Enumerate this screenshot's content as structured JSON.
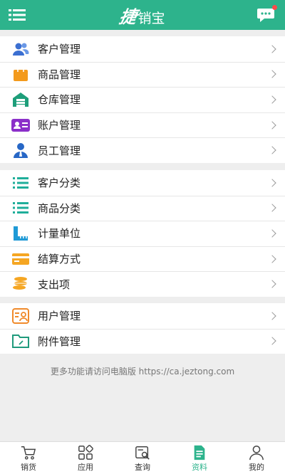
{
  "header": {
    "logo_mark": "捷",
    "logo_rest": "销宝",
    "menu_icon": "menu-icon",
    "chat_icon": "chat-bubble-icon",
    "accent": "#2db38c"
  },
  "groups": [
    {
      "items": [
        {
          "label": "客户管理",
          "icon": "customers-icon",
          "color": "#3b6fd1"
        },
        {
          "label": "商品管理",
          "icon": "shopping-bag-icon",
          "color": "#f39a1c"
        },
        {
          "label": "仓库管理",
          "icon": "warehouse-icon",
          "color": "#1e9e7a"
        },
        {
          "label": "账户管理",
          "icon": "account-card-icon",
          "color": "#8b2fc9"
        },
        {
          "label": "员工管理",
          "icon": "employee-icon",
          "color": "#2767c6"
        }
      ]
    },
    {
      "items": [
        {
          "label": "客户分类",
          "icon": "list-icon",
          "color": "#1fae9a"
        },
        {
          "label": "商品分类",
          "icon": "list-icon",
          "color": "#1fae9a"
        },
        {
          "label": "计量单位",
          "icon": "ruler-icon",
          "color": "#1f9ad6"
        },
        {
          "label": "结算方式",
          "icon": "card-icon",
          "color": "#f5a623"
        },
        {
          "label": "支出项",
          "icon": "coins-icon",
          "color": "#f5a623"
        }
      ]
    },
    {
      "items": [
        {
          "label": "用户管理",
          "icon": "user-profile-icon",
          "color": "#f08a2a"
        },
        {
          "label": "附件管理",
          "icon": "folder-icon",
          "color": "#1f9a7c"
        }
      ]
    }
  ],
  "footer_note": "更多功能请访问电脑版 https://ca.jeztong.com",
  "tabs": [
    {
      "label": "销货",
      "icon": "cart-icon",
      "active": false
    },
    {
      "label": "应用",
      "icon": "apps-grid-icon",
      "active": false
    },
    {
      "label": "查询",
      "icon": "search-doc-icon",
      "active": false
    },
    {
      "label": "资料",
      "icon": "document-icon",
      "active": true
    },
    {
      "label": "我的",
      "icon": "person-icon",
      "active": false
    }
  ]
}
